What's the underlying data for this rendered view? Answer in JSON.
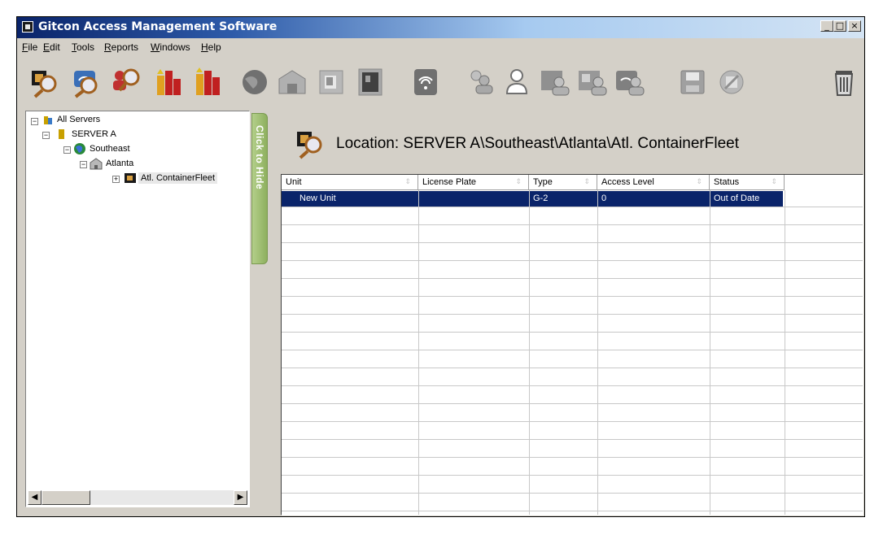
{
  "window": {
    "title": "Gitcon Access Management Software",
    "buttons": [
      "_",
      "□",
      "×"
    ]
  },
  "menu": [
    "File",
    "Edit",
    "Tools",
    "Reports",
    "Windows",
    "Help"
  ],
  "toolbar": {
    "icons": [
      "search-unit-icon",
      "search-wireless-icon",
      "search-users-icon",
      "report-icon",
      "report-alt-icon",
      "globe-icon",
      "building-icon",
      "panel-icon",
      "device-icon",
      "wireless-icon",
      "users-icon",
      "user-icon",
      "user-group-icon",
      "user-group-remote-icon",
      "user-group-wireless-icon",
      "save-icon",
      "cancel-icon",
      "delete-icon"
    ]
  },
  "tree": {
    "root": "All Servers",
    "server": "SERVER A",
    "region": "Southeast",
    "city": "Atlanta",
    "fleet": "Atl. ContainerFleet"
  },
  "hide_tab": "Click to Hide",
  "location": {
    "text": "Location: SERVER A\\Southeast\\Atlanta\\Atl. ContainerFleet"
  },
  "table": {
    "columns": [
      "Unit",
      "License Plate",
      "Type",
      "Access Level",
      "Status"
    ],
    "rows": [
      {
        "unit": "New Unit",
        "license_plate": "",
        "type": "G-2",
        "access_level": "0",
        "status": "Out of Date"
      }
    ]
  },
  "colors": {
    "selection": "#0a246a",
    "hide_tab": "#9bbd6c",
    "window_face": "#d4d0c8"
  }
}
